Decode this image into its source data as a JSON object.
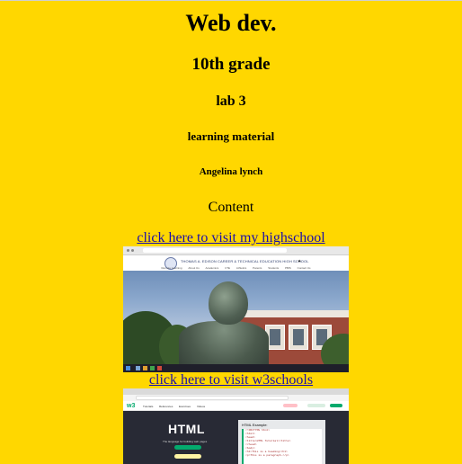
{
  "page": {
    "title": "Web dev.",
    "grade": "10th grade",
    "lab": "lab 3",
    "subtitle": "learning material",
    "author": "Angelina lynch",
    "section": "Content",
    "background_color": "#FFD700"
  },
  "links": [
    {
      "text": "click here to visit my highschool"
    },
    {
      "text": "click here to visit w3schools"
    }
  ],
  "screenshot_highschool": {
    "site_title": "THOMAS A. EDISON CAREER & TECHNICAL EDUCATION HIGH SCHOOL",
    "nav": [
      "Remote Learning",
      "About Us",
      "Academics",
      "CTE",
      "Athletics",
      "Parents",
      "Students",
      "PBIS",
      "Contact Us"
    ],
    "social_icon": "twitter-icon"
  },
  "screenshot_w3schools": {
    "logo": "w3",
    "nav": [
      "Tutorials",
      "References",
      "Exercises",
      "Videos"
    ],
    "hero_heading": "HTML",
    "hero_sub": "The language for building web pages",
    "panel_title": "HTML Example:",
    "code_lines": [
      "<!DOCTYPE html>",
      "<html>",
      "<head>",
      "<title>HTML Tutorial</title>",
      "</head>",
      "<body>",
      "<h1>This is a heading</h1>",
      "<p>This is a paragraph.</p>"
    ],
    "accent_color": "#04AA6D"
  }
}
